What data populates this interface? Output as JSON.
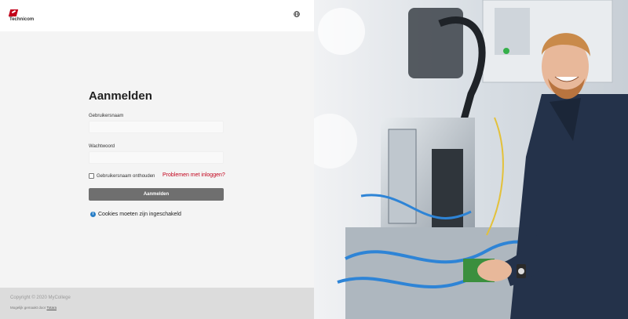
{
  "brand": {
    "name": "Technicom"
  },
  "form": {
    "title": "Aanmelden",
    "username_label": "Gebruikersnaam",
    "username_value": "",
    "password_label": "Wachtwoord",
    "password_value": "",
    "remember_label": "Gebruikersnaam onthouden",
    "trouble_link": "Problemen met inloggen?",
    "submit_label": "Aanmelden"
  },
  "notice": {
    "cookies": "Cookies moeten zijn ingeschakeld"
  },
  "footer": {
    "copyright": "Copyright © 2020 MyCollege",
    "powered_prefix": "Mogelijk gemaakt door",
    "powered_link": "Totara"
  },
  "colors": {
    "accent": "#c2001a",
    "button": "#6f6f6f",
    "info": "#2a7fc7"
  },
  "icons": {
    "language": "globe-icon",
    "info": "info-icon"
  }
}
